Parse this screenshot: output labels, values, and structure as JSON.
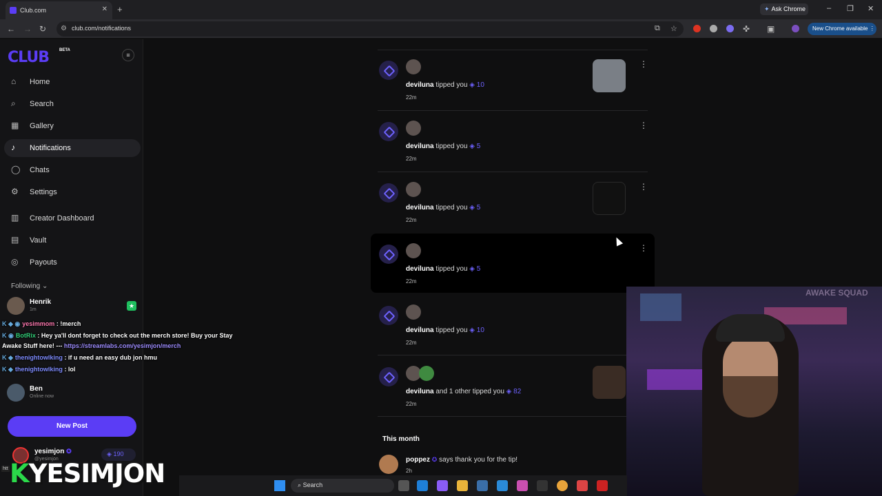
{
  "browser": {
    "tab_title": "Club.com",
    "url": "club.com/notifications",
    "ask_chrome": "Ask Chrome",
    "new_chrome": "New Chrome available",
    "new_tab": "+",
    "tab_close": "✕"
  },
  "sidebar": {
    "logo": "CLUB",
    "beta": "BETA",
    "nav": [
      {
        "label": "Home",
        "icon": "home-icon"
      },
      {
        "label": "Search",
        "icon": "search-icon"
      },
      {
        "label": "Gallery",
        "icon": "gallery-icon"
      },
      {
        "label": "Notifications",
        "icon": "bell-icon",
        "active": true
      },
      {
        "label": "Chats",
        "icon": "chat-icon"
      },
      {
        "label": "Settings",
        "icon": "gear-icon"
      },
      {
        "label": "Creator Dashboard",
        "icon": "dashboard-icon"
      },
      {
        "label": "Vault",
        "icon": "vault-icon"
      },
      {
        "label": "Payouts",
        "icon": "payouts-icon"
      }
    ],
    "following_label": "Following",
    "following": [
      {
        "name": "Henrik",
        "sub": "1m"
      },
      {
        "name": "Ben",
        "sub": "Online now"
      }
    ],
    "new_post": "New Post",
    "me": {
      "name": "yesimjon",
      "handle": "@yesimjon",
      "balance": "190"
    }
  },
  "stream_overlay": {
    "chat": [
      {
        "user": "yesimmom",
        "text": ": !merch"
      },
      {
        "user": "BotRix",
        "text": ": Hey ya'll dont forget to check out the merch store! Buy your Stay"
      },
      {
        "text": "Awake Stuff here! --- ",
        "link": "https://streamlabs.com/yesimjon/merch"
      },
      {
        "user": "thenightowlking",
        "text": ": if u need an easy dub jon hmu"
      },
      {
        "user": "thenightowlking",
        "text": ": lol"
      }
    ],
    "brand": "YESIMJON",
    "brand_k": "K",
    "status_link": "htt"
  },
  "notifications": [
    {
      "user": "deviluna",
      "action": "tipped you",
      "amount": "10",
      "time": "22m",
      "thumb": "photo"
    },
    {
      "user": "deviluna",
      "action": "tipped you",
      "amount": "5",
      "time": "22m",
      "thumb": ""
    },
    {
      "user": "deviluna",
      "action": "tipped you",
      "amount": "5",
      "time": "22m",
      "thumb": "dark"
    },
    {
      "user": "deviluna",
      "action": "tipped you",
      "amount": "5",
      "time": "22m",
      "thumb": ""
    },
    {
      "user": "deviluna",
      "action": "tipped you",
      "amount": "10",
      "time": "22m",
      "thumb": ""
    },
    {
      "user": "deviluna",
      "action": "and 1 other tipped you",
      "amount": "82",
      "time": "22m",
      "thumb": "face"
    }
  ],
  "section_month": "This month",
  "month_item": {
    "user": "poppez",
    "text": "says thank you for the tip!",
    "time": "2h"
  },
  "taskbar": {
    "search": "Search"
  },
  "webcam": {
    "sign": "AWAKE SQUAD"
  },
  "colors": {
    "accent": "#5b3df5",
    "background": "#0f0f10"
  }
}
